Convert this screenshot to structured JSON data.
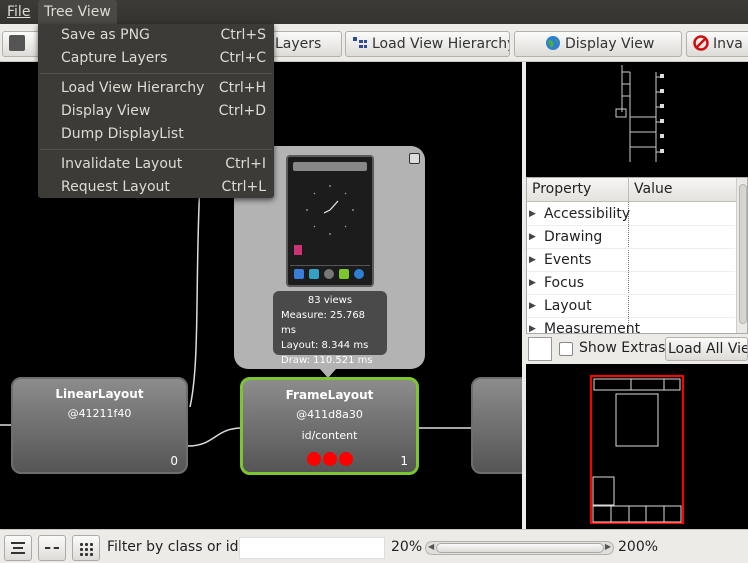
{
  "menubar": {
    "file": "File",
    "tree_view": "Tree View"
  },
  "toolbar": {
    "capture_layers": "Layers",
    "load_view_hierarchy": "Load View Hierarchy",
    "display_view": "Display View",
    "invalidate": "Inva"
  },
  "tree_menu": {
    "items": [
      {
        "label": "Save as PNG",
        "shortcut": "Ctrl+S"
      },
      {
        "label": "Capture Layers",
        "shortcut": "Ctrl+C"
      },
      {
        "label": "Load View Hierarchy",
        "shortcut": "Ctrl+H"
      },
      {
        "label": "Display View",
        "shortcut": "Ctrl+D"
      },
      {
        "label": "Dump DisplayList",
        "shortcut": ""
      },
      {
        "label": "Invalidate Layout",
        "shortcut": "Ctrl+I"
      },
      {
        "label": "Request Layout",
        "shortcut": "Ctrl+L"
      }
    ]
  },
  "nodes": {
    "linear": {
      "title": "LinearLayout",
      "addr": "@41211f40",
      "count": "0"
    },
    "frame": {
      "title": "FrameLayout",
      "addr": "@411d8a30",
      "id": "id/content",
      "count": "1"
    }
  },
  "stats": {
    "views": "83 views",
    "measure": "Measure: 25.768 ms",
    "layout": "Layout: 8.344 ms",
    "draw": "Draw: 110.521 ms"
  },
  "properties": {
    "header_property": "Property",
    "header_value": "Value",
    "rows": [
      "Accessibility",
      "Drawing",
      "Events",
      "Focus",
      "Layout",
      "Measurement"
    ]
  },
  "extras": {
    "show_extras": "Show Extras",
    "load_all": "Load All Vie"
  },
  "status": {
    "filter_label": "Filter by class or id:",
    "filter_value": "",
    "zoom_min": "20%",
    "zoom_max": "200%",
    "zoom_level": 0.06
  },
  "colors": {
    "selected_border": "#7cc62f",
    "menu_bg": "#3c3b37",
    "preview_outline": "#ff0000"
  }
}
